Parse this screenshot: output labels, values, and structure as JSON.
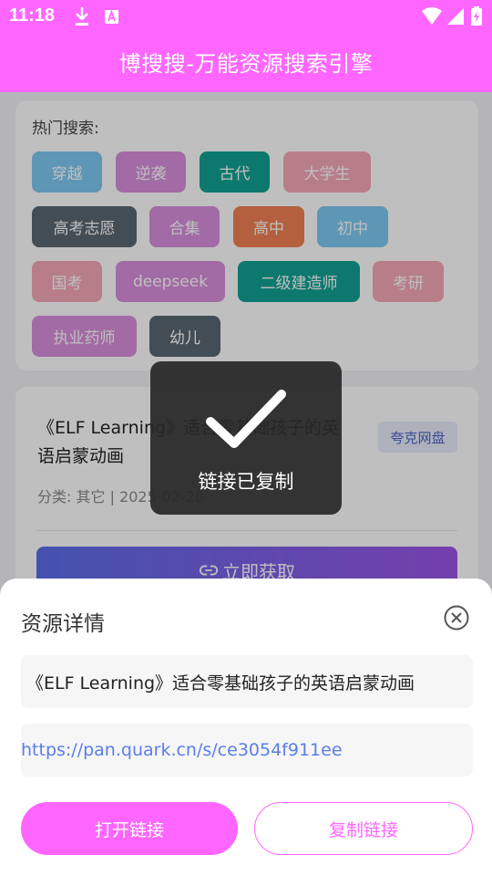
{
  "status_bar": {
    "time": "11:18",
    "icons": [
      "download-icon",
      "a-notification-icon",
      "wifi-icon",
      "signal-icon",
      "battery-charging-icon"
    ]
  },
  "header": {
    "title": "博搜搜-万能资源搜索引擎"
  },
  "hot_search": {
    "title": "热门搜索:",
    "tags": [
      {
        "label": "穿越",
        "color": "#7ec8f2"
      },
      {
        "label": "逆袭",
        "color": "#d98fdc"
      },
      {
        "label": "古代",
        "color": "#12a293"
      },
      {
        "label": "大学生",
        "color": "#f4a9b7"
      },
      {
        "label": "高考志愿",
        "color": "#5a6772"
      },
      {
        "label": "合集",
        "color": "#d98fdc"
      },
      {
        "label": "高中",
        "color": "#f07f52"
      },
      {
        "label": "初中",
        "color": "#7ec8f2"
      },
      {
        "label": "国考",
        "color": "#f4a9b7"
      },
      {
        "label": "deepseek",
        "color": "#d98fdc"
      },
      {
        "label": "二级建造师",
        "color": "#12a293"
      },
      {
        "label": "考研",
        "color": "#f4a9b7"
      },
      {
        "label": "执业药师",
        "color": "#d98fdc"
      },
      {
        "label": "幼儿",
        "color": "#5a6772"
      }
    ]
  },
  "resource_card": {
    "title": "《ELF Learning》适合零基础孩子的英语启蒙动画",
    "badge": "夸克网盘",
    "meta": "分类: 其它 | 2025-02-20",
    "get_button": "立即获取"
  },
  "toast": {
    "text": "链接已复制"
  },
  "sheet": {
    "title": "资源详情",
    "resource_name": "《ELF Learning》适合零基础孩子的英语启蒙动画",
    "resource_url": "https://pan.quark.cn/s/ce3054f911ee",
    "open_button": "打开链接",
    "copy_button": "复制链接"
  },
  "colors": {
    "brand": "#ff66ff",
    "link": "#5b7ee6",
    "button_gradient_start": "#5b6ee8",
    "button_gradient_end": "#9b55e6"
  }
}
